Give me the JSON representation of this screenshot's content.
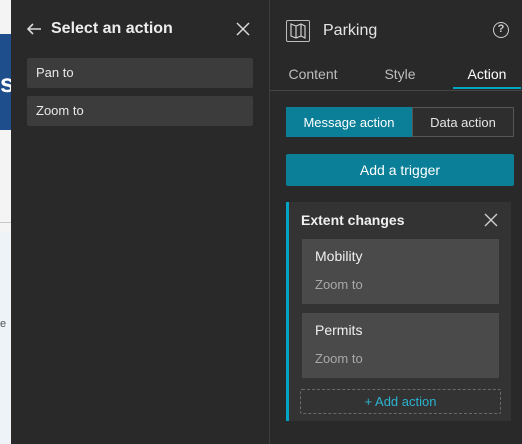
{
  "background": {
    "glyph": "s",
    "snippet": "e"
  },
  "left_panel": {
    "title": "Select an action",
    "actions": [
      "Pan to",
      "Zoom to"
    ]
  },
  "right_panel": {
    "title": "Parking",
    "help_glyph": "?",
    "tabs": [
      {
        "label": "Content",
        "active": false
      },
      {
        "label": "Style",
        "active": false
      },
      {
        "label": "Action",
        "active": true
      }
    ],
    "segmented": {
      "message": "Message action",
      "data": "Data action",
      "selected": "message"
    },
    "add_trigger": "Add a trigger",
    "trigger": {
      "title": "Extent changes",
      "actions": [
        {
          "name": "Mobility",
          "action": "Zoom to"
        },
        {
          "name": "Permits",
          "action": "Zoom to"
        }
      ],
      "add_action": "+ Add action"
    }
  },
  "colors": {
    "accent": "#0a7f97",
    "highlight": "#00a5c4",
    "panel": "#292929",
    "card": "#333333"
  },
  "icons": [
    "back-arrow-icon",
    "close-icon",
    "map-icon",
    "help-icon"
  ]
}
